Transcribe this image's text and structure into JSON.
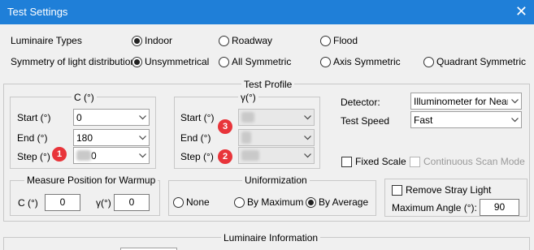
{
  "window": {
    "title": "Test Settings",
    "close_glyph": "✕",
    "close_icon": "close-icon"
  },
  "luminaire_types": {
    "label": "Luminaire Types",
    "options": [
      "Indoor",
      "Roadway",
      "Flood"
    ],
    "selected": "Indoor"
  },
  "symmetry": {
    "label": "Symmetry of light distribution",
    "options": [
      "Unsymmetrical",
      "All Symmetric",
      "Axis Symmetric",
      "Quadrant Symmetric"
    ],
    "selected": "Unsymmetrical"
  },
  "test_profile": {
    "title": "Test Profile",
    "c_group": {
      "title": "C (°)",
      "start_label": "Start (°)",
      "start_value": "0",
      "end_label": "End (°)",
      "end_value": "180",
      "step_label": "Step (°)",
      "step_value": "0"
    },
    "gamma_group": {
      "title": "γ(°)",
      "start_label": "Start (°)",
      "end_label": "End (°)",
      "step_label": "Step (°)"
    },
    "detector_label": "Detector:",
    "detector_value": "Illuminometer for Near F",
    "test_speed_label": "Test Speed",
    "test_speed_value": "Fast",
    "fixed_scale_label": "Fixed Scale",
    "continuous_scan_label": "Continuous Scan Mode"
  },
  "warmup": {
    "title": "Measure Position for Warmup",
    "c_label": "C (°)",
    "c_value": "0",
    "gamma_label": "γ(°)",
    "gamma_value": "0"
  },
  "uniformization": {
    "title": "Uniformization",
    "options": [
      "None",
      "By Maximum",
      "By Average"
    ],
    "selected": "By Average"
  },
  "stray": {
    "remove_label": "Remove Stray Light",
    "max_angle_label": "Maximum Angle (°):",
    "max_angle_value": "90"
  },
  "luminaire_information": {
    "title": "Luminaire Information"
  },
  "badges": [
    "1",
    "2",
    "3"
  ],
  "colors": {
    "titlebar": "#1f7fd8",
    "badge": "#e8343a"
  }
}
